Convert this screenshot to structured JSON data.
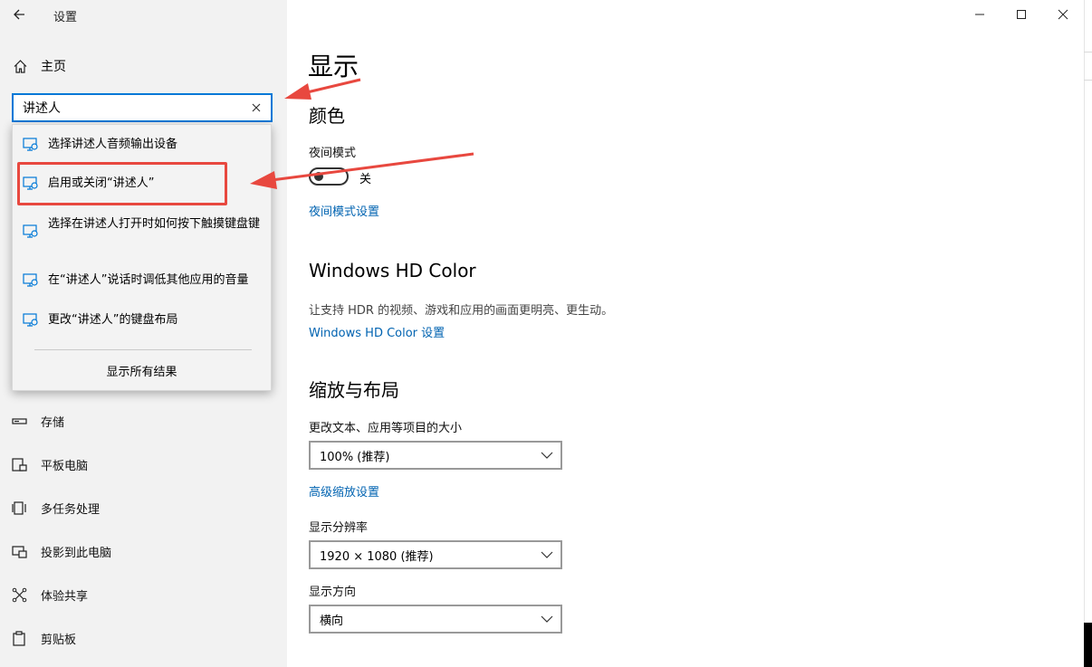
{
  "window": {
    "title": "设置",
    "back_icon": "back-arrow-icon",
    "controls": {
      "minimize_icon": "minimize-icon",
      "maximize_icon": "maximize-icon",
      "close_icon": "close-icon"
    }
  },
  "sidebar": {
    "home_label": "主页",
    "search": {
      "value": "讲述人",
      "clear_icon": "close-icon"
    },
    "suggestions": [
      {
        "label": "选择讲述人音频输出设备",
        "icon": "monitor-settings-icon"
      },
      {
        "label": "启用或关闭“讲述人”",
        "icon": "monitor-settings-icon"
      },
      {
        "label": "选择在讲述人打开时如何按下触摸键盘键",
        "icon": "monitor-settings-icon"
      },
      {
        "label": "在“讲述人”说话时调低其他应用的音量",
        "icon": "monitor-settings-icon"
      },
      {
        "label": "更改“讲述人”的键盘布局",
        "icon": "monitor-settings-icon"
      }
    ],
    "show_all_results": "显示所有结果",
    "nav_items": [
      {
        "label": "存储",
        "icon": "storage-icon"
      },
      {
        "label": "平板电脑",
        "icon": "tablet-icon"
      },
      {
        "label": "多任务处理",
        "icon": "multitasking-icon"
      },
      {
        "label": "投影到此电脑",
        "icon": "projection-icon"
      },
      {
        "label": "体验共享",
        "icon": "shared-experiences-icon"
      },
      {
        "label": "剪贴板",
        "icon": "clipboard-icon"
      }
    ]
  },
  "main": {
    "title": "显示",
    "color_section": {
      "heading": "颜色",
      "night_light_label": "夜间模式",
      "night_light_state": "关",
      "night_light_on": false,
      "night_light_settings_link": "夜间模式设置"
    },
    "hd_color_section": {
      "heading": "Windows HD Color",
      "description": "让支持 HDR 的视频、游戏和应用的画面更明亮、更生动。",
      "settings_link": "Windows HD Color 设置"
    },
    "scale_section": {
      "heading": "缩放与布局",
      "scale_label": "更改文本、应用等项目的大小",
      "scale_value": "100% (推荐)",
      "advanced_scaling_link": "高级缩放设置",
      "resolution_label": "显示分辨率",
      "resolution_value": "1920 × 1080 (推荐)",
      "orientation_label": "显示方向",
      "orientation_value": "横向"
    }
  },
  "annotations": {
    "arrow_color": "#e8483f",
    "highlight_color": "#e8483f"
  },
  "colors": {
    "accent": "#0078d7",
    "link": "#0063b1",
    "sidebar_bg": "#f2f2f2"
  }
}
